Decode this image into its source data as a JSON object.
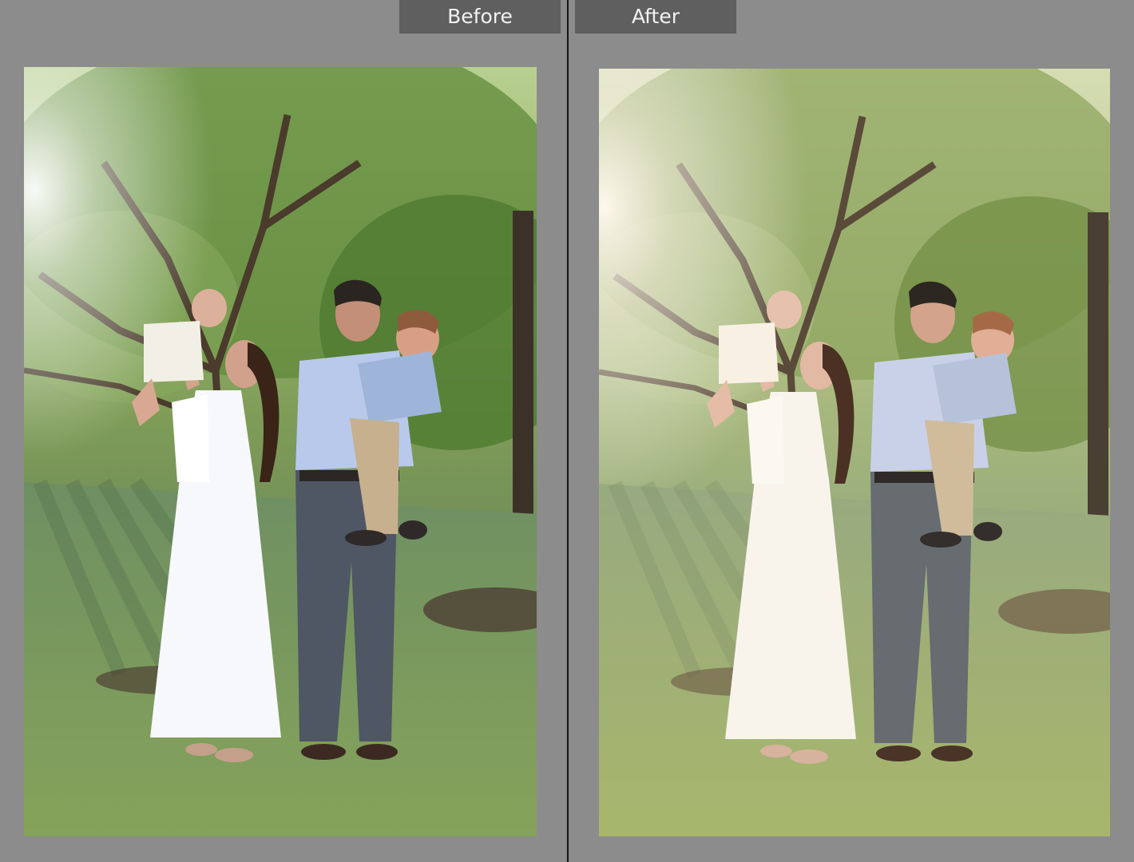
{
  "compare_view": {
    "before_label": "Before",
    "after_label": "After"
  },
  "colors": {
    "workspace_bg": "#8c8c8c",
    "label_bg": "#5f5f5f",
    "label_text": "#f2f2f2",
    "divider": "#151515"
  }
}
